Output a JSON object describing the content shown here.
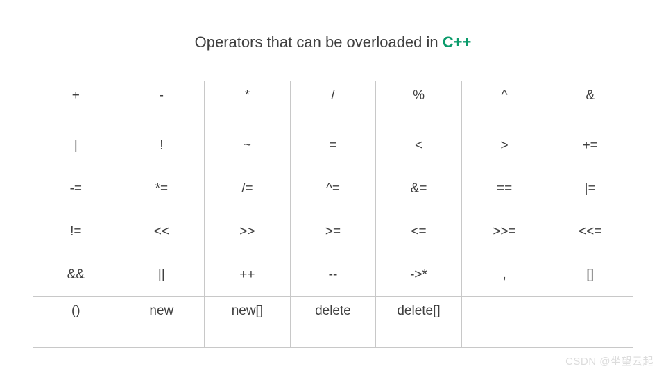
{
  "title": {
    "prefix": "Operators that can be overloaded in ",
    "accent": "C++"
  },
  "table": {
    "rows": [
      [
        "+",
        "-",
        "*",
        "/",
        "%",
        "^",
        "&"
      ],
      [
        "|",
        "!",
        "~",
        "=",
        "<",
        ">",
        "+="
      ],
      [
        "-=",
        "*=",
        "/=",
        "^=",
        "&=",
        "==",
        "|="
      ],
      [
        "!=",
        "<<",
        ">>",
        ">=",
        "<=",
        ">>=",
        "<<="
      ],
      [
        "&&",
        "||",
        "++",
        "--",
        "->*",
        ",",
        "[]"
      ],
      [
        "()",
        "new",
        "new[]",
        "delete",
        "delete[]",
        "",
        ""
      ]
    ]
  },
  "watermark": "CSDN @坐望云起"
}
